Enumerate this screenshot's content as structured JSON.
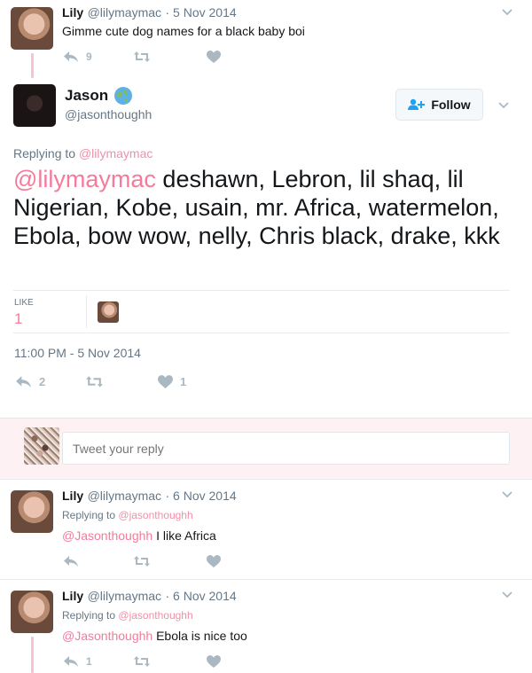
{
  "tweet1": {
    "name": "Lily",
    "handle": "@lilymaymac",
    "date": "5 Nov 2014",
    "text": "Gimme cute dog names for a black baby boi",
    "reply_count": "9"
  },
  "main_tweet": {
    "name": "Jason",
    "handle": "@jasonthoughh",
    "follow_label": "Follow",
    "replying_to_prefix": "Replying to",
    "replying_to_handle": "@lilymaymac",
    "mention": "@lilymaymac",
    "text": " deshawn, Lebron, lil shaq, lil Nigerian, Kobe, usain, mr. Africa, watermelon, Ebola, bow wow, nelly, Chris black, drake, kkk",
    "likes_label": "LIKE",
    "likes_value": "1",
    "timestamp": "11:00 PM - 5 Nov 2014",
    "reply_count": "2",
    "like_count": "1"
  },
  "reply_box": {
    "placeholder": "Tweet your reply"
  },
  "tweet3": {
    "name": "Lily",
    "handle": "@lilymaymac",
    "date": "6 Nov 2014",
    "replying_to_prefix": "Replying to",
    "replying_to_handle": "@jasonthoughh",
    "mention": "@Jasonthoughh",
    "text": " I like Africa"
  },
  "tweet4": {
    "name": "Lily",
    "handle": "@lilymaymac",
    "date": "6 Nov 2014",
    "replying_to_prefix": "Replying to",
    "replying_to_handle": "@jasonthoughh",
    "mention": "@Jasonthoughh",
    "text": " Ebola is nice too",
    "reply_count": "1"
  },
  "colors": {
    "accent_pink": "#f57a9b",
    "icon_gray": "#aab8c2",
    "follow_blue": "#1da1f2"
  },
  "icons": [
    "chevron-down-icon",
    "reply-icon",
    "retweet-icon",
    "heart-icon",
    "globe-icon",
    "add-user-icon"
  ]
}
